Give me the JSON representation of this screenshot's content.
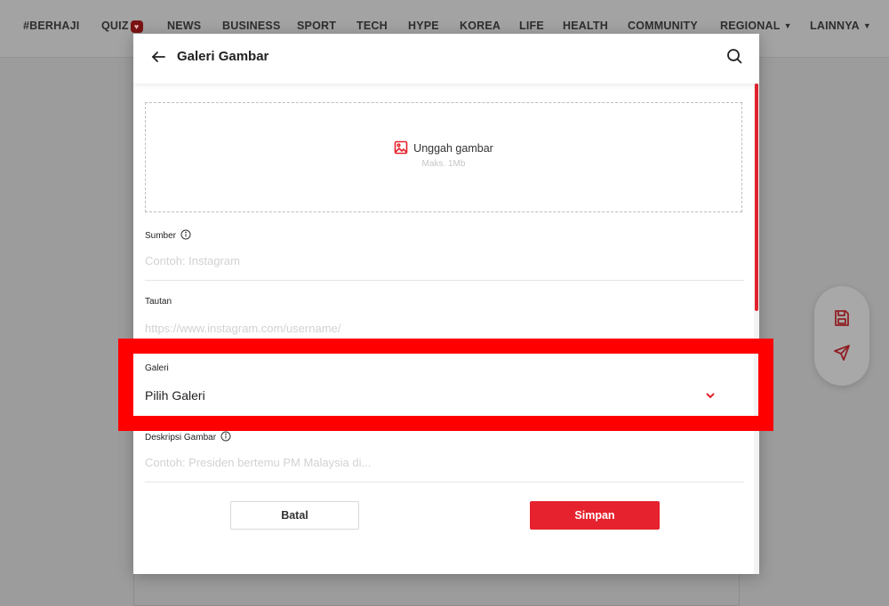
{
  "nav": {
    "items": [
      "#BERHAJI",
      "QUIZ",
      "NEWS",
      "BUSINESS",
      "SPORT",
      "TECH",
      "HYPE",
      "KOREA",
      "LIFE",
      "HEALTH",
      "COMMUNITY",
      "REGIONAL",
      "LAINNYA"
    ],
    "caret": "▼"
  },
  "modal": {
    "title": "Galeri Gambar",
    "upload": {
      "label": "Unggah gambar",
      "hint": "Maks. 1Mb"
    },
    "fields": {
      "sumber": {
        "label": "Sumber",
        "placeholder": "Contoh: Instagram"
      },
      "tautan": {
        "label": "Tautan",
        "placeholder": "https://www.instagram.com/username/"
      },
      "galeri": {
        "label": "Galeri",
        "value": "Pilih Galeri"
      },
      "deskripsi": {
        "label": "Deskripsi Gambar",
        "placeholder": "Contoh: Presiden bertemu PM Malaysia di..."
      }
    },
    "buttons": {
      "cancel": "Batal",
      "save": "Simpan"
    }
  },
  "colors": {
    "accent": "#e5222d",
    "highlight": "#ff0000"
  }
}
